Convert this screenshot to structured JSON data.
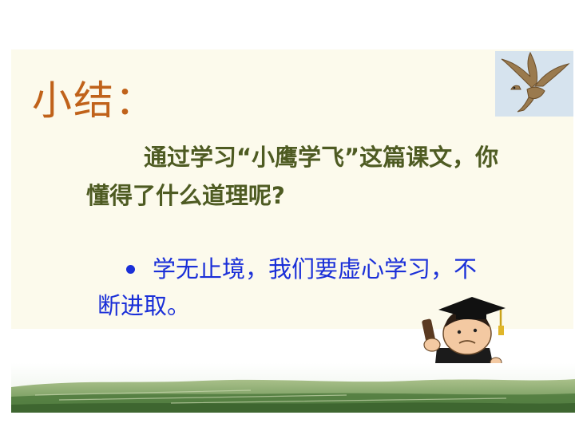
{
  "slide": {
    "title": "小结：",
    "question": "通过学习“小鹰学飞”这篇课文，你懂得了什么道理呢?",
    "answer": "学无止境，我们要虚心学习，不断进取。"
  },
  "images": {
    "eagle": "eagle-photo",
    "scholar": "graduate-cartoon",
    "landscape": "green-field-strip"
  },
  "colors": {
    "title": "#c0621a",
    "question": "#4e5b22",
    "answer": "#1a2fd8",
    "panel": "#fcfaec"
  }
}
